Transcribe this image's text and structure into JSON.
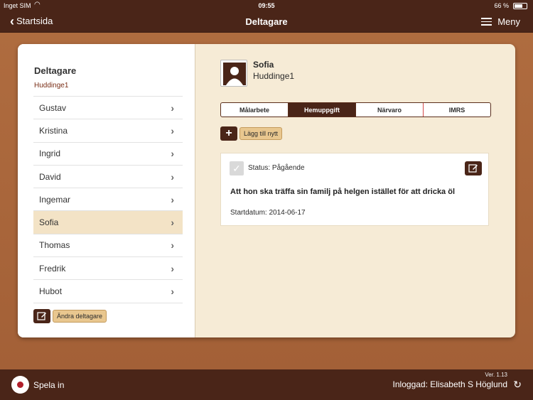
{
  "status_bar": {
    "carrier": "Inget SIM",
    "time": "09:55",
    "battery": "66 %"
  },
  "nav": {
    "back_label": "Startsida",
    "title": "Deltagare",
    "menu_label": "Meny"
  },
  "sidebar": {
    "title": "Deltagare",
    "group": "Huddinge1",
    "participants": [
      "Gustav",
      "Kristina",
      "Ingrid",
      "David",
      "Ingemar",
      "Sofia",
      "Thomas",
      "Fredrik",
      "Hubot"
    ],
    "selected_index": 5,
    "edit_label": "Ändra deltagare"
  },
  "detail": {
    "name": "Sofia",
    "group": "Huddinge1",
    "tabs": [
      "Målarbete",
      "Hemuppgift",
      "Närvaro",
      "IMRS"
    ],
    "active_tab": 1,
    "add_label": "Lägg till nytt",
    "task": {
      "status": "Status: Pågående",
      "goal": "Att hon ska träffa sin familj på helgen istället för att dricka öl",
      "start_date": "Startdatum: 2014-06-17"
    }
  },
  "bottom": {
    "record_label": "Spela in",
    "version": "Ver. 1.13",
    "logged_in": "Inloggad: Elisabeth S Höglund"
  },
  "colors": {
    "bar": "#4a2518",
    "background": "#a5643a",
    "card": "#f6ebd6",
    "accent": "#e9c78f",
    "record": "#b01e2a"
  }
}
